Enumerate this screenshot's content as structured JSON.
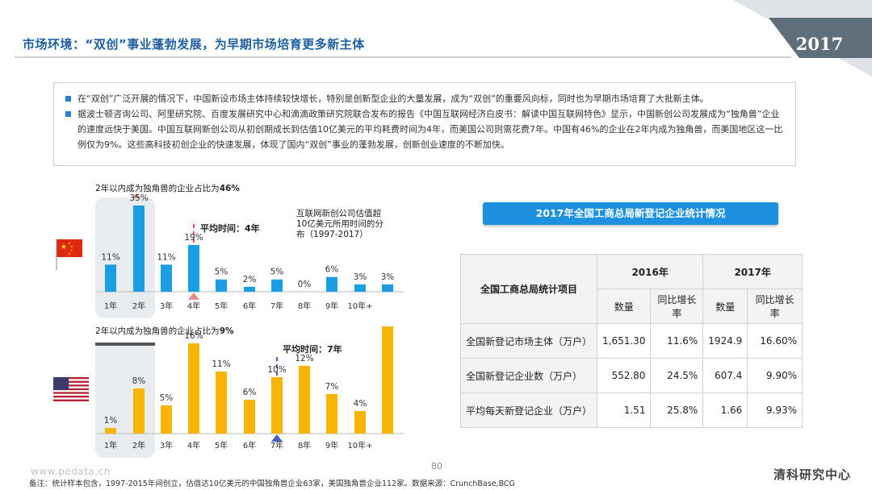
{
  "header": {
    "title": "市场环境：“双创”事业蓬勃发展，为早期市场培育更多新主体",
    "year_badge": "2017"
  },
  "intro": {
    "bullets": [
      "在“双创”广泛开展的情况下，中国新设市场主体持续较快增长，特别是创新型企业的大量发展，成为“双创”的重要风向标，同时也为早期市场培育了大批新主体。",
      "据波士顿咨询公司、阿里研究院、百度发展研究中心和滴滴政策研究院联合发布的报告《中国互联网经济白皮书：解读中国互联网特色》显示，中国新创公司发展成为“独角兽”企业的速度远快于美国。中国互联网新创公司从初创期成长到估值10亿美元的平均耗费时间为4年，而美国公司则需花费7年。中国有46%的企业在2年内成为独角兽，而美国地区这一比例仅为9%。这些高科技初创企业的快速发展，体现了国内“双创”事业的蓬勃发展，创新创业速度的不断加快。"
    ]
  },
  "colors": {
    "title_blue": "#1f5f9f",
    "china_bar": "#1a9de3",
    "us_bar": "#f7b500",
    "banner_blue": "#1e90e0",
    "avg_marker_china": "#e88b8b",
    "avg_marker_us": "#4a5fb5",
    "dashed_line": "#e05a5a"
  },
  "chart_data": [
    {
      "type": "bar",
      "country": "china",
      "flag_icon": "china-flag-icon",
      "headline_prefix": "2年以内成为独角兽的企业占比为",
      "headline_value": "46%",
      "avg_label": "平均时间：4年",
      "avg_year_index": 3,
      "note": "互联网新创公司估值超10亿美元所用时间的分布（1997-2017）",
      "note_lines": [
        "互联网新创公司估值超",
        "10亿美元所用时间的分",
        "布（1997-2017）"
      ],
      "categories": [
        "1年",
        "2年",
        "3年",
        "4年",
        "5年",
        "6年",
        "7年",
        "8年",
        "9年",
        "10年+"
      ],
      "values": [
        11,
        35,
        11,
        19,
        5,
        2,
        5,
        0,
        6,
        3,
        3
      ],
      "labels": [
        "11%",
        "35%",
        "11%",
        "19%",
        "5%",
        "2%",
        "5%",
        "0%",
        "6%",
        "3%",
        "3%"
      ],
      "ylim": [
        0,
        35
      ]
    },
    {
      "type": "bar",
      "country": "us",
      "flag_icon": "us-flag-icon",
      "headline_prefix": "2年以内成为独角兽的企业占比为",
      "headline_value": "9%",
      "avg_label": "平均时间：7年",
      "avg_year_index": 6,
      "categories": [
        "1年",
        "2年",
        "3年",
        "4年",
        "5年",
        "6年",
        "7年",
        "8年",
        "9年",
        "10年+"
      ],
      "values": [
        1,
        8,
        5,
        16,
        11,
        6,
        10,
        12,
        7,
        4,
        19
      ],
      "labels": [
        "1%",
        "8%",
        "5%",
        "16%",
        "11%",
        "6%",
        "10%",
        "12%",
        "7%",
        "4%",
        "19%"
      ],
      "ylim": [
        0,
        19
      ]
    }
  ],
  "table": {
    "banner": "2017年全国工商总局新登记企业统计情况",
    "corner_label": "全国工商总局统计项目",
    "years": [
      "2016年",
      "2017年"
    ],
    "sub_headers": [
      "数量",
      "同比增长率",
      "数量",
      "同比增长率"
    ],
    "rows": [
      {
        "label": "全国新登记市场主体（万户）",
        "cells": [
          "1,651.30",
          "11.6%",
          "1924.9",
          "16.60%"
        ]
      },
      {
        "label": "全国新登记企业数（万户）",
        "cells": [
          "552.80",
          "24.5%",
          "607.4",
          "9.90%"
        ]
      },
      {
        "label": "平均每天新登记企业（万户）",
        "cells": [
          "1.51",
          "25.8%",
          "1.66",
          "9.93%"
        ]
      }
    ]
  },
  "footer": {
    "url": "www.pedata.cn",
    "page_number": "80",
    "note": "备注：统计样本包含，1997-2015年间创立，估值达10亿美元的中国独角兽企业63家，美国独角兽企业112家。数据来源：CrunchBase,BCG",
    "brand": "清科研究中心"
  }
}
